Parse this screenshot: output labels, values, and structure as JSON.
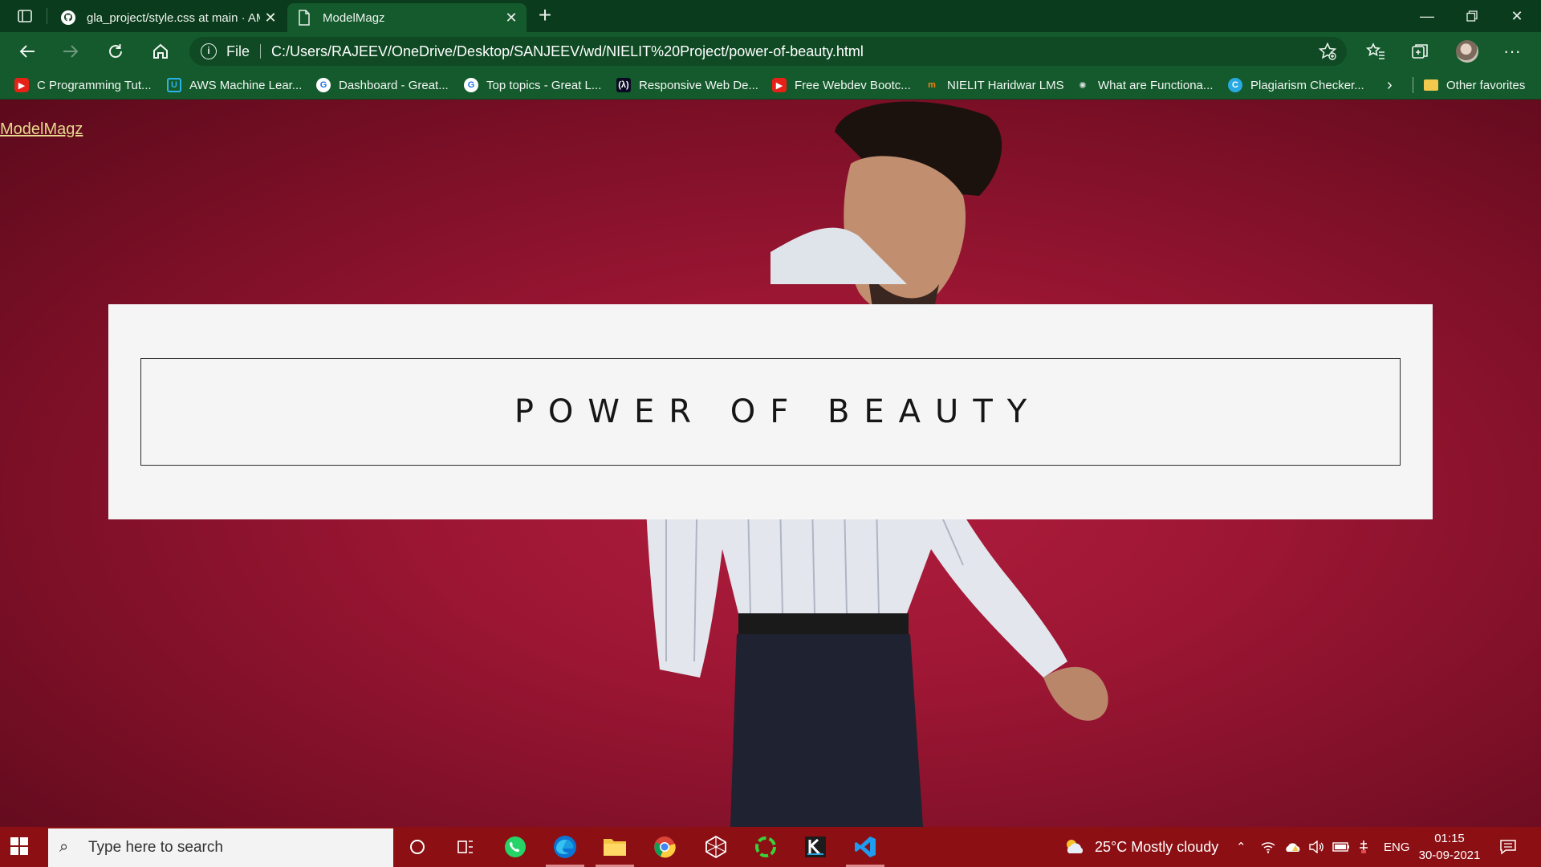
{
  "browser": {
    "tabs": [
      {
        "label": "gla_project/style.css at main · AM",
        "icon": "github-icon",
        "active": false
      },
      {
        "label": "ModelMagz",
        "icon": "page-icon",
        "active": true
      }
    ],
    "new_tab": "+",
    "address": {
      "scheme_label": "File",
      "url": "C:/Users/RAJEEV/OneDrive/Desktop/SANJEEV/wd/NIELIT%20Project/power-of-beauty.html"
    },
    "favorites": [
      {
        "label": "C Programming Tut...",
        "icon": "youtube-icon"
      },
      {
        "label": "AWS Machine Lear...",
        "icon": "udacity-icon"
      },
      {
        "label": "Dashboard - Great...",
        "icon": "google-icon"
      },
      {
        "label": "Top topics - Great L...",
        "icon": "google-icon"
      },
      {
        "label": "Responsive Web De...",
        "icon": "freecodecamp-icon"
      },
      {
        "label": "Free Webdev Bootc...",
        "icon": "youtube-icon"
      },
      {
        "label": "NIELIT Haridwar LMS",
        "icon": "moodle-icon"
      },
      {
        "label": "What are Functiona...",
        "icon": "site-icon"
      },
      {
        "label": "Plagiarism Checker...",
        "icon": "checker-icon"
      }
    ],
    "other_favorites": "Other favorites"
  },
  "page": {
    "brand_link": "ModelMagz",
    "hero_title": "POWER OF BEAUTY",
    "background_color": "#9c1633"
  },
  "taskbar": {
    "search_placeholder": "Type here to search",
    "weather": "25°C  Mostly cloudy",
    "language": "ENG",
    "time": "01:15",
    "date": "30-09-2021",
    "color": "#8c0f13"
  }
}
